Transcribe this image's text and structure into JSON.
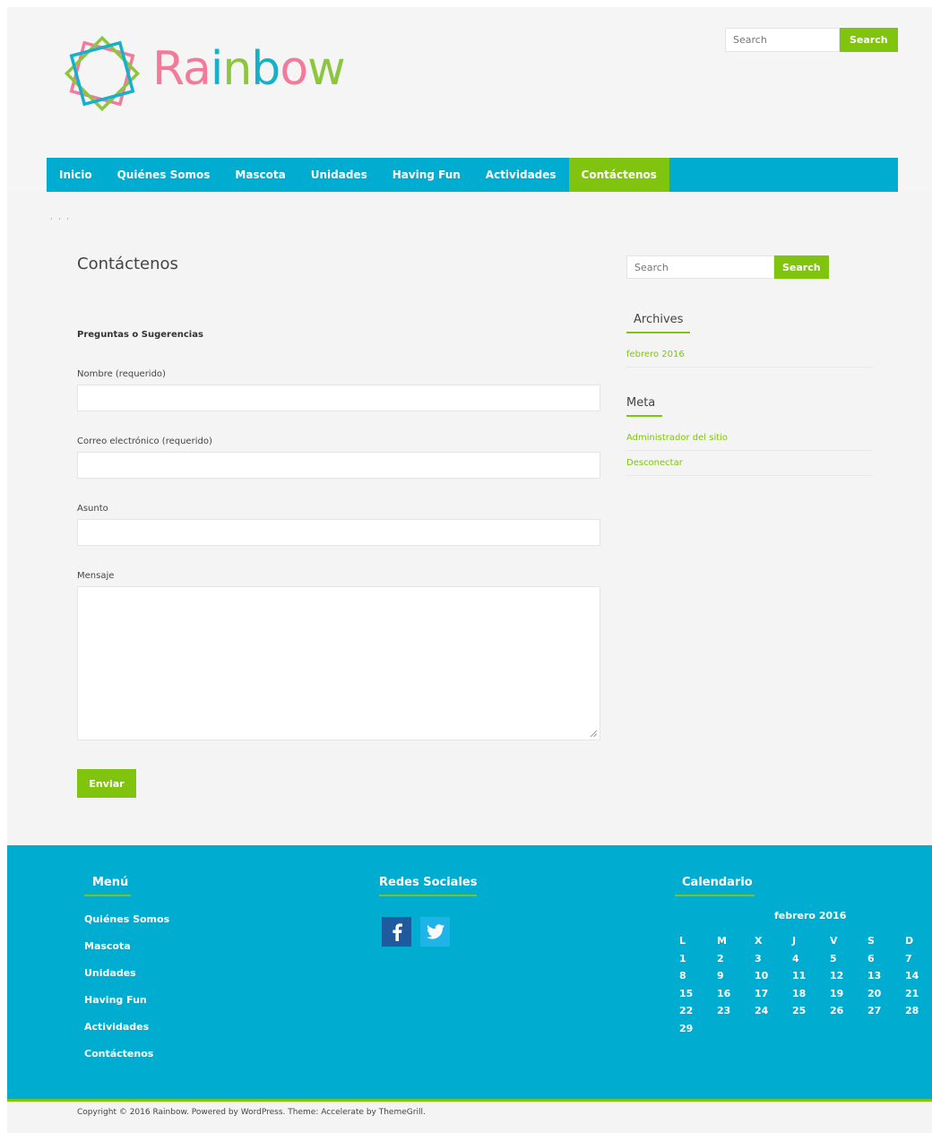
{
  "header": {
    "logo_text": "Rainbow",
    "logo_letters": [
      {
        "ch": "R",
        "color": "#f47a9b"
      },
      {
        "ch": "a",
        "color": "#f47a9b"
      },
      {
        "ch": "i",
        "color": "#14b0cc"
      },
      {
        "ch": "n",
        "color": "#8cc63f"
      },
      {
        "ch": "b",
        "color": "#14b0cc"
      },
      {
        "ch": "o",
        "color": "#f47a9b"
      },
      {
        "ch": "w",
        "color": "#8cc63f"
      }
    ],
    "search": {
      "placeholder": "Search",
      "button": "Search"
    }
  },
  "nav": {
    "items": [
      {
        "label": "Inicio"
      },
      {
        "label": "Quiénes Somos"
      },
      {
        "label": "Mascota"
      },
      {
        "label": "Unidades"
      },
      {
        "label": "Having Fun"
      },
      {
        "label": "Actividades"
      },
      {
        "label": "Contáctenos",
        "active": true
      }
    ]
  },
  "breadcrumb_dots": "· ·   ·",
  "main": {
    "title": "Contáctenos",
    "form": {
      "heading": "Preguntas o Sugerencias",
      "fields": [
        {
          "label": "Nombre (requerido)",
          "value": ""
        },
        {
          "label": "Correo electrónico (requerido)",
          "value": ""
        },
        {
          "label": "Asunto",
          "value": ""
        },
        {
          "label": "Mensaje",
          "value": ""
        }
      ],
      "submit": "Enviar"
    }
  },
  "sidebar": {
    "search": {
      "placeholder": "Search",
      "button": "Search"
    },
    "archives": {
      "title": "Archives",
      "links": [
        "febrero 2016"
      ]
    },
    "meta": {
      "title": "Meta",
      "links": [
        "Administrador del sitio",
        "Desconectar"
      ]
    }
  },
  "footer": {
    "menu": {
      "title": "Menú",
      "items": [
        "Quiénes Somos",
        "Mascota",
        "Unidades",
        "Having Fun",
        "Actividades",
        "Contáctenos"
      ]
    },
    "social": {
      "title": "Redes Sociales",
      "icons": [
        "facebook-icon",
        "twitter-icon"
      ]
    },
    "calendar": {
      "title": "Calendario",
      "caption": "febrero 2016",
      "weekdays": [
        "L",
        "M",
        "X",
        "J",
        "V",
        "S",
        "D"
      ],
      "weeks": [
        [
          "1",
          "2",
          "3",
          "4",
          "5",
          "6",
          "7"
        ],
        [
          "8",
          "9",
          "10",
          "11",
          "12",
          "13",
          "14"
        ],
        [
          "15",
          "16",
          "17",
          "18",
          "19",
          "20",
          "21"
        ],
        [
          "22",
          "23",
          "24",
          "25",
          "26",
          "27",
          "28"
        ],
        [
          "29",
          "",
          "",
          "",
          "",
          "",
          ""
        ]
      ]
    }
  },
  "copyright": "Copyright © 2016 Rainbow. Powered by WordPress. Theme: Accelerate by ThemeGrill.",
  "colors": {
    "accent": "#80c410",
    "primary": "#00acd0"
  }
}
